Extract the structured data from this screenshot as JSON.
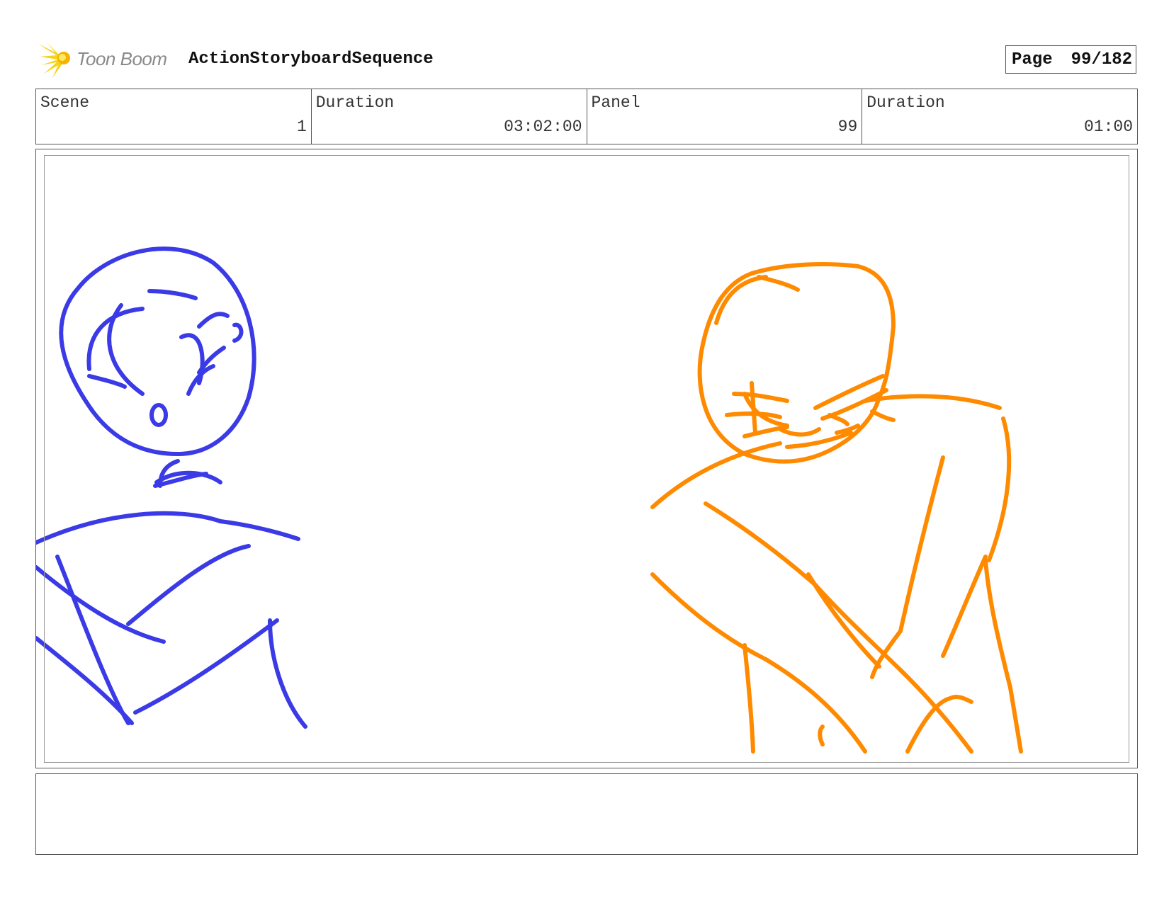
{
  "header": {
    "logo_text": "Toon Boom",
    "logo_icon": "toon-boom-star-icon",
    "project_title": "ActionStoryboardSequence",
    "page_label": "Page",
    "page_value": "99/182"
  },
  "info": {
    "scene_label": "Scene",
    "scene_value": "1",
    "scene_duration_label": "Duration",
    "scene_duration_value": "03:02:00",
    "panel_label": "Panel",
    "panel_value": "99",
    "panel_duration_label": "Duration",
    "panel_duration_value": "01:00"
  },
  "sketch": {
    "left_character_color": "#3a3ae6",
    "right_character_color": "#ff8a00"
  },
  "notes": {
    "text": ""
  }
}
